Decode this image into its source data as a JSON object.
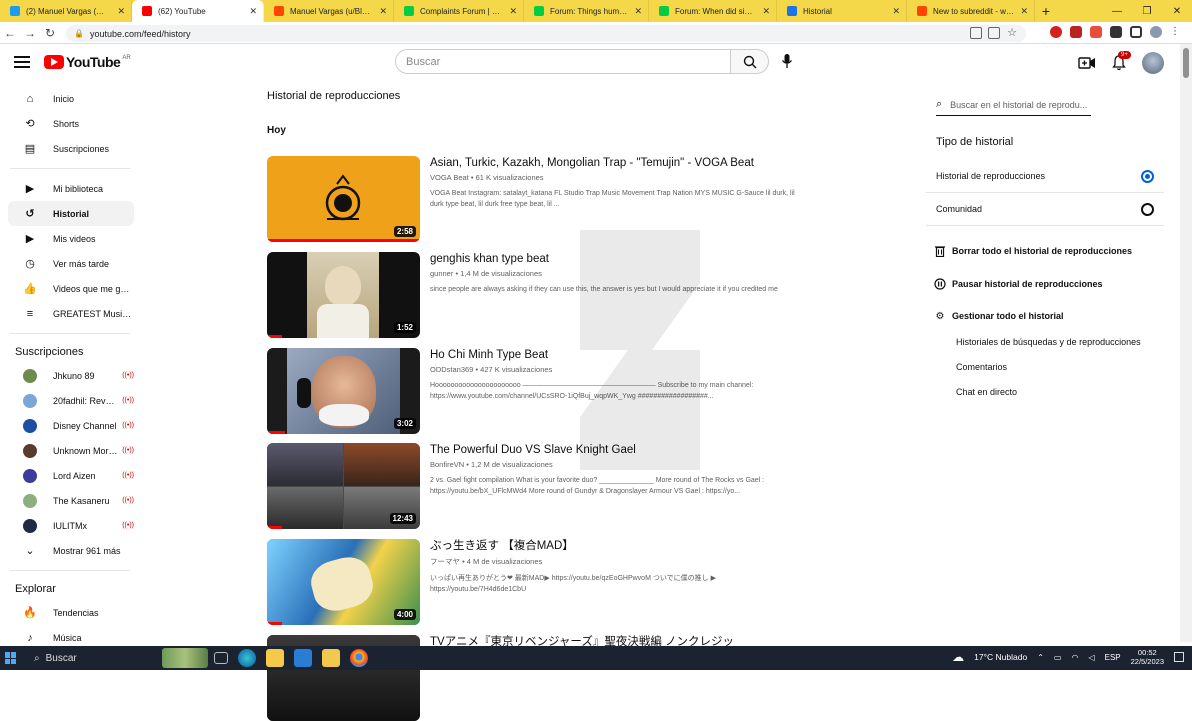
{
  "browser": {
    "tabs": [
      {
        "title": "(2) Manuel Vargas (@Man...",
        "favicon_color": "#1d9bf0",
        "active": false
      },
      {
        "title": "(62) YouTube",
        "favicon_color": "#ff0000",
        "active": true
      },
      {
        "title": "Manuel Vargas (u/BlackPa...",
        "favicon_color": "#ff4500",
        "active": false
      },
      {
        "title": "Complaints Forum | Devia...",
        "favicon_color": "#05cc47",
        "active": false
      },
      {
        "title": "Forum: Things humans wo...",
        "favicon_color": "#05cc47",
        "active": false
      },
      {
        "title": "Forum: When did sincerity...",
        "favicon_color": "#05cc47",
        "active": false
      },
      {
        "title": "Historial",
        "favicon_color": "#1a73e8",
        "active": false
      },
      {
        "title": "New to subreddit - what a...",
        "favicon_color": "#ff4500",
        "active": false
      }
    ],
    "url": "youtube.com/feed/history"
  },
  "header": {
    "logo_text": "YouTube",
    "country_code": "AR",
    "search_placeholder": "Buscar",
    "notifications_badge": "9+"
  },
  "sidebar": {
    "main_items": [
      {
        "label": "Inicio",
        "icon": "home-icon",
        "glyph": "⌂"
      },
      {
        "label": "Shorts",
        "icon": "shorts-icon",
        "glyph": "⟲"
      },
      {
        "label": "Suscripciones",
        "icon": "subscriptions-icon",
        "glyph": "▤"
      }
    ],
    "library_items": [
      {
        "label": "Mi biblioteca",
        "icon": "library-icon",
        "glyph": "▶"
      },
      {
        "label": "Historial",
        "icon": "history-icon",
        "glyph": "↺",
        "active": true
      },
      {
        "label": "Mis videos",
        "icon": "my-videos-icon",
        "glyph": "▶"
      },
      {
        "label": "Ver más tarde",
        "icon": "watch-later-icon",
        "glyph": "◷"
      },
      {
        "label": "Videos que me gus...",
        "icon": "like-icon",
        "glyph": "👍"
      },
      {
        "label": "GREATEST Music o...",
        "icon": "playlist-icon",
        "glyph": "≡"
      }
    ],
    "subscriptions_title": "Suscripciones",
    "subscriptions": [
      {
        "label": "Jhkuno 89",
        "color": "#6d8a4f"
      },
      {
        "label": "20fadhil: Revolut...",
        "color": "#7aa7d6"
      },
      {
        "label": "Disney Channel",
        "color": "#1c4fa3"
      },
      {
        "label": "Unknown Mortal ...",
        "color": "#5a3b2e"
      },
      {
        "label": "Lord Aizen",
        "color": "#3c3c9e"
      },
      {
        "label": "The Kasaneru",
        "color": "#8fae7e"
      },
      {
        "label": "IULITMx",
        "color": "#1f2a44"
      }
    ],
    "show_more": "Mostrar 961 más",
    "explore_title": "Explorar",
    "explore_items": [
      {
        "label": "Tendencias",
        "icon": "trending-icon",
        "glyph": "🔥"
      },
      {
        "label": "Música",
        "icon": "music-icon",
        "glyph": "♪"
      }
    ]
  },
  "main": {
    "page_title": "Historial de reproducciones",
    "day_label": "Hoy",
    "videos": [
      {
        "title": "Asian, Turkic, Kazakh, Mongolian Trap - \"Temujin\" - VOGA Beat",
        "channel": "VOGA Beat",
        "views": "61 K visualizaciones",
        "description": "VOGA Beat Instagram: satalayt_katana FL Studio Trap Music Movement Trap Nation MYS MUSIC G-Sauce lil durk, lil durk type beat, lil durk free type beat, lil ...",
        "duration": "2:58",
        "progress": 1.0,
        "thumb_bg": "#f0a11a"
      },
      {
        "title": "genghis khan type beat",
        "channel": "gunner",
        "views": "1,4 M de visualizaciones",
        "description": "since people are always asking if they can use this, the answer is yes but I would appreciate it if you credited me",
        "duration": "1:52",
        "progress": 0.1,
        "thumb_bg": "#111111"
      },
      {
        "title": "Ho Chi Minh Type Beat",
        "channel": "ODDstan369",
        "views": "427 K visualizaciones",
        "description": "Hoooooooooooooooooooooo ——————————————————— Subscribe to my main channel: https://www.youtube.com/channel/UCsSRO-1iQfBuj_wqpWK_Ywg ##################...",
        "duration": "3:02",
        "progress": 0.12,
        "thumb_bg": "#1b1b1b"
      },
      {
        "title": "The Powerful Duo VS Slave Knight Gael",
        "channel": "BonfireVN",
        "views": "1,2 M de visualizaciones",
        "description": "2 vs. Gael fight compilation What is your favorite duo? ______________ More round of The Rocks vs Gael : https://youtu.be/bX_UFlcMWd4 More round of Gundyr & Dragonslayer Armour VS Gael : https://yo...",
        "duration": "12:43",
        "progress": 0.1,
        "thumb_bg": "#4a4a4a"
      },
      {
        "title": "ぶっ生き返す 【複合MAD】",
        "channel": "フーマヤ",
        "views": "4 M de visualizaciones",
        "description": "いっぱい再生ありがとう❤ 最新MAD▶ https://youtu.be/qzEoGHPwvoM ついでに僕の推し ▶ https://youtu.be/7H4d6de1CbU",
        "duration": "4:00",
        "progress": 0.1,
        "thumb_bg": "#2a6fb8"
      },
      {
        "title": "TVアニメ『東京リベンジャーズ』聖夜決戦編 ノンクレジッ",
        "channel": "",
        "views": "",
        "description": "",
        "duration": "",
        "progress": 0,
        "thumb_bg": "#222222"
      }
    ]
  },
  "history_panel": {
    "search_placeholder": "Buscar en el historial de reprodu...",
    "type_title": "Tipo de historial",
    "options": [
      {
        "label": "Historial de reproducciones",
        "selected": true
      },
      {
        "label": "Comunidad",
        "selected": false
      }
    ],
    "actions": [
      {
        "label": "Borrar todo el historial de reproducciones",
        "icon": "trash-icon",
        "glyph": "🗑"
      },
      {
        "label": "Pausar historial de reproducciones",
        "icon": "pause-icon",
        "glyph": "⏸"
      },
      {
        "label": "Gestionar todo el historial",
        "icon": "gear-icon",
        "glyph": "⚙"
      }
    ],
    "sub_links": [
      "Historiales de búsquedas y de reproducciones",
      "Comentarios",
      "Chat en directo"
    ]
  },
  "taskbar": {
    "search_label": "Buscar",
    "weather": "17°C  Nublado",
    "language": "ESP",
    "time": "00:52",
    "date": "22/5/2023"
  }
}
